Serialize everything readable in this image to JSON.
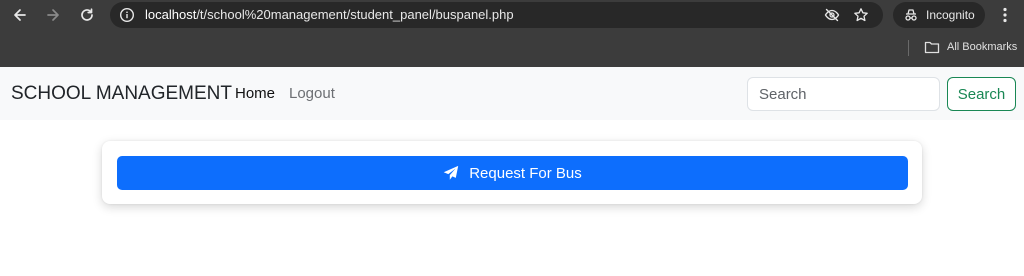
{
  "browser": {
    "url_host": "localhost",
    "url_path": "/t/school%20management/student_panel/buspanel.php",
    "incognito_label": "Incognito",
    "bookmarks_label": "All Bookmarks"
  },
  "navbar": {
    "brand": "SCHOOL MANAGEMENT",
    "links": [
      "Home",
      "Logout"
    ],
    "search_placeholder": "Search",
    "search_button": "Search"
  },
  "card": {
    "request_button_label": "Request For Bus",
    "request_button_icon": "paper-plane-icon"
  },
  "colors": {
    "primary": "#0d6efd",
    "success": "#198754",
    "chrome_bg": "#3c3c3c",
    "navbar_bg": "#f8f9fa"
  }
}
